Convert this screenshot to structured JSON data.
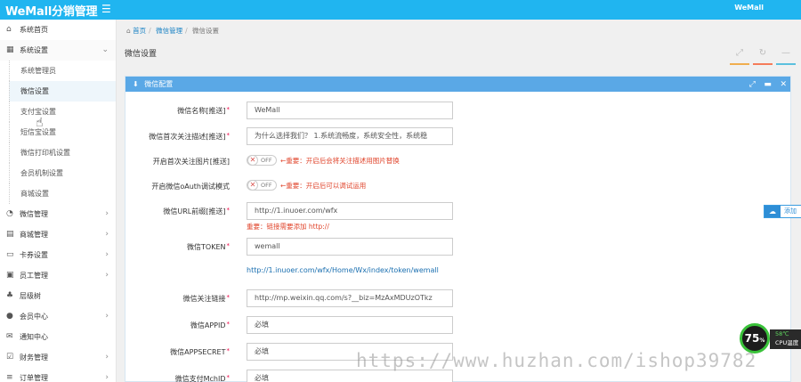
{
  "header": {
    "brand": "WeMall分销管理",
    "menu_icon": "hamburger-icon",
    "user": "WeMall",
    "bg_color": "#20b5f0"
  },
  "sidebar": {
    "items": [
      {
        "label": "系统首页",
        "icon": "home-icon"
      },
      {
        "label": "系统设置",
        "icon": "grid-icon",
        "expanded": true
      },
      {
        "label": "微信管理",
        "icon": "wechat-icon"
      },
      {
        "label": "商城管理",
        "icon": "store-icon"
      },
      {
        "label": "卡券设置",
        "icon": "card-icon"
      },
      {
        "label": "员工管理",
        "icon": "staff-icon"
      },
      {
        "label": "层级树",
        "icon": "tree-icon"
      },
      {
        "label": "会员中心",
        "icon": "member-icon"
      },
      {
        "label": "通知中心",
        "icon": "mail-icon"
      },
      {
        "label": "财务管理",
        "icon": "finance-icon"
      },
      {
        "label": "订单管理",
        "icon": "order-icon"
      }
    ],
    "sub_items": [
      {
        "label": "系统管理员"
      },
      {
        "label": "微信设置",
        "active": true
      },
      {
        "label": "支付宝设置"
      },
      {
        "label": "短信宝设置"
      },
      {
        "label": "微信打印机设置"
      },
      {
        "label": "会员机制设置"
      },
      {
        "label": "商城设置"
      }
    ]
  },
  "breadcrumb": {
    "home": "首页",
    "section": "微信管理",
    "current": "微信设置"
  },
  "page": {
    "title": "微信设置",
    "accent_colors": [
      "#f0ad4e",
      "#f57c5a",
      "#5bc0de"
    ]
  },
  "panel": {
    "title": "微信配置",
    "header_color": "#5aa8e6",
    "fields": {
      "name": {
        "label": "微信名称[推送]",
        "value": "WeMall"
      },
      "desc": {
        "label": "微信首次关注描述[推送]",
        "value": "为什么选择我们？ 1.系统流畅度，系统安全性，系统稳"
      },
      "pic": {
        "label": "开启首次关注图片[推送]",
        "toggle": "OFF",
        "note": "←重要：开启后会将关注描述用图片替换"
      },
      "oauth": {
        "label": "开启微信oAuth调试模式",
        "toggle": "OFF",
        "note": "←重要：开启后可以调试运用"
      },
      "url": {
        "label": "微信URL前缀[推送]",
        "value": "http://1.inuoer.com/wfx",
        "help": "重要：链接需要添加 http://"
      },
      "token": {
        "label": "微信TOKEN",
        "value": "wemall",
        "link": "http://1.inuoer.com/wfx/Home/Wx/index/token/wemall"
      },
      "follow": {
        "label": "微信关注链接",
        "value": "http://mp.weixin.qq.com/s?__biz=MzAxMDUzOTkz"
      },
      "appid": {
        "label": "微信APPID",
        "value": "必填"
      },
      "appsecret": {
        "label": "微信APPSECRET",
        "value": "必填"
      },
      "mchid": {
        "label": "微信支付MchID",
        "value": "必填"
      }
    }
  },
  "widgets": {
    "share_text": "添加",
    "cpu_percent": "75",
    "cpu_temp": "58℃",
    "cpu_label": "CPU温度"
  },
  "watermark": "https://www.huzhan.com/ishop39782"
}
